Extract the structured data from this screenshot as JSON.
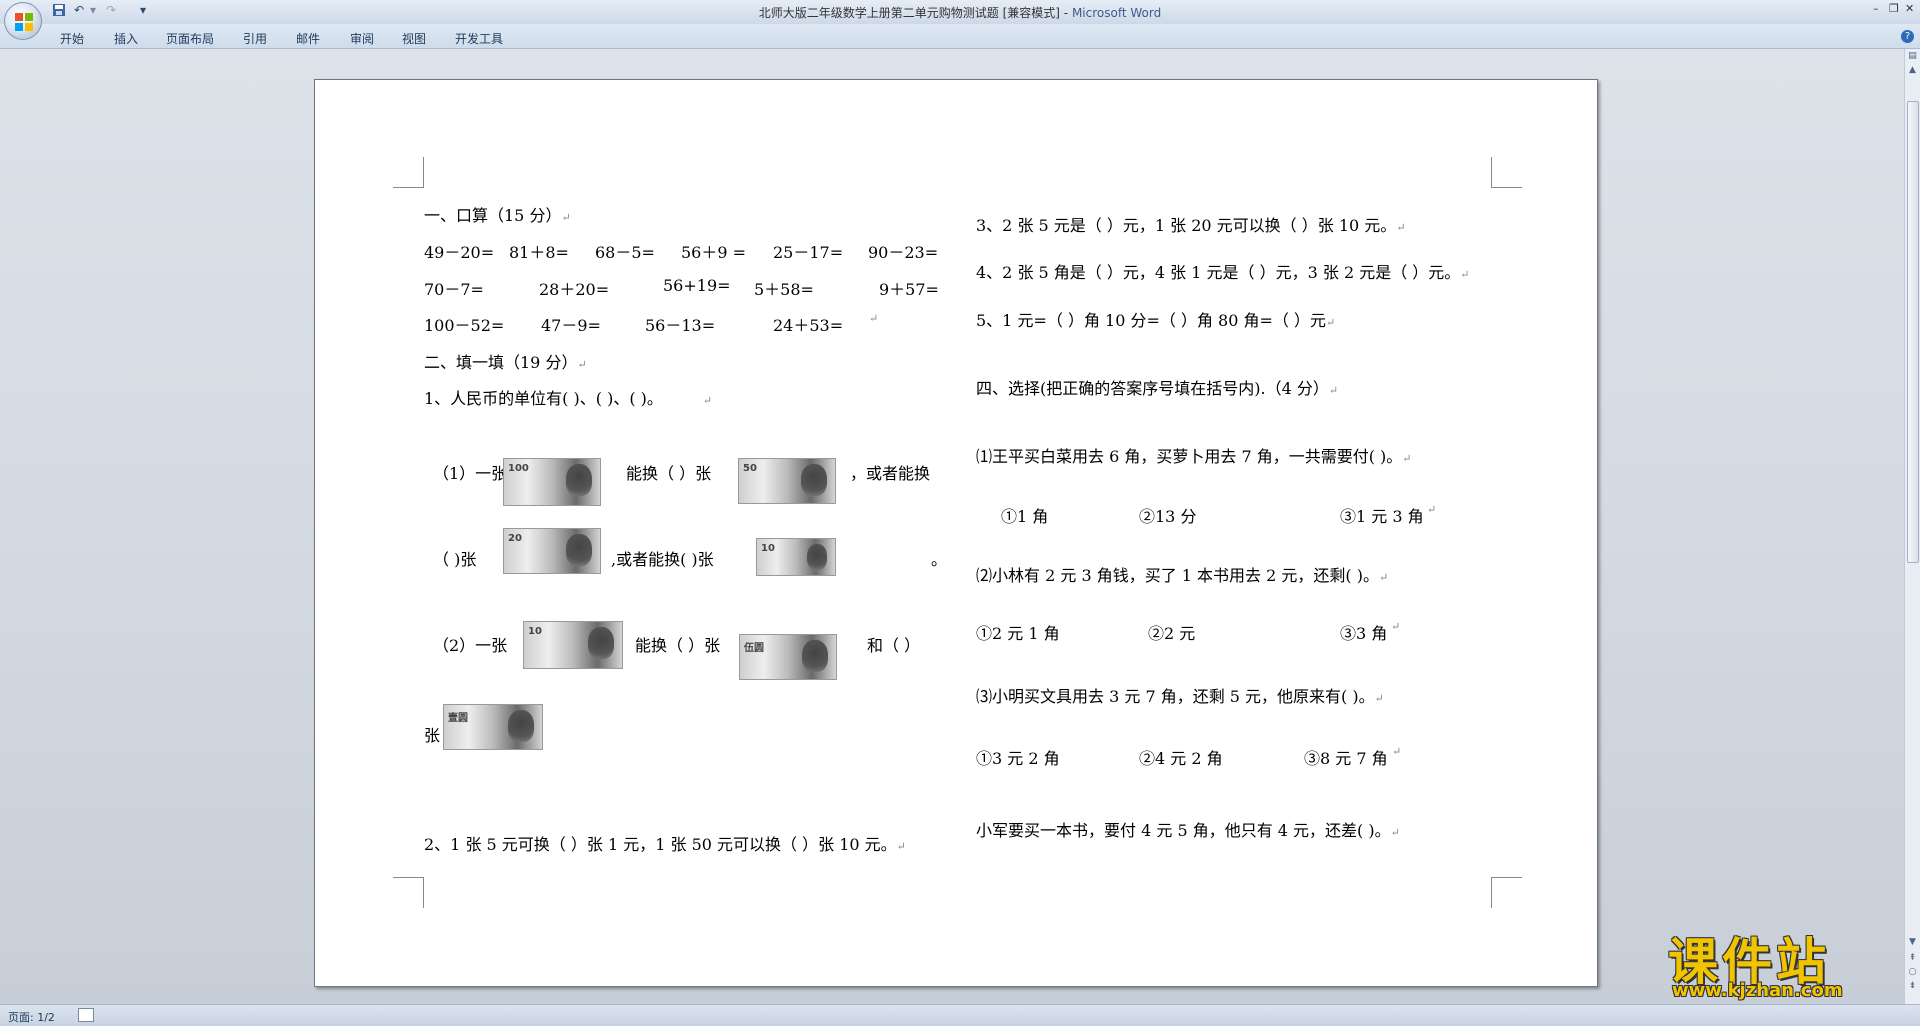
{
  "titlebar": {
    "doc_title": "北师大版二年级数学上册第二单元购物测试题 [兼容模式]",
    "separator": " - ",
    "app_name": "Microsoft Word",
    "qa_customize": "▾"
  },
  "tabs": [
    "开始",
    "插入",
    "页面布局",
    "引用",
    "邮件",
    "审阅",
    "视图",
    "开发工具"
  ],
  "help": "?",
  "document": {
    "left": {
      "sec1": "一、口算（15 分）",
      "r1": [
        "49－20=",
        "81＋8=",
        "68－5=",
        "56＋9 =",
        "25－17=",
        "90－23="
      ],
      "r2": [
        "70－7=",
        "28＋20=",
        "56+19=",
        "5＋58=",
        "9＋57="
      ],
      "r3": [
        "100－52=",
        "47－9=",
        "56－13=",
        "24＋53="
      ],
      "sec2": "二、填一填（19 分）",
      "q1": "1、人民币的单位有(          )、(          )、(          )。",
      "q1a_prefix": "（1）一张",
      "q1a_mid": "能换（    ）张",
      "q1a_suffix": "，或者能换",
      "q1b_prefix": "（    )张",
      "q1b_mid": ",或者能换(    )张",
      "q1b_end": "。",
      "q2a_prefix": "（2）一张",
      "q2a_mid": "能换（  ）张",
      "q2a_suffix": "和（    ）",
      "q2b_prefix": "张",
      "q2": "2、1 张 5 元可换（    ）张 1 元，1 张 50 元可以换（    ）张 10 元。"
    },
    "right": {
      "q3": "3、2 张 5 元是（       ）元，1 张 20 元可以换（        ）张 10 元。",
      "q4": "4、2 张 5 角是（   ）元，4 张 1 元是（  ）元，3 张 2 元是（  ）元。",
      "q5": "5、1 元=（   ）角    10 分=（    ）角   80 角=（   ）元",
      "sec4": "四、选择(把正确的答案序号填在括号内).（4 分）",
      "c1": "⑴王平买白菜用去 6 角，买萝卜用去 7 角，一共需要付(       )。",
      "c1_opts": [
        "①1 角",
        "②13 分",
        "③1 元 3 角"
      ],
      "c2": "⑵小林有 2 元 3 角钱，买了 1 本书用去 2 元，还剩(       )。",
      "c2_opts": [
        "①2 元 1 角",
        "②2 元",
        "③3 角"
      ],
      "c3": "⑶小明买文具用去 3 元 7 角，还剩 5 元，他原来有(              )。",
      "c3_opts": [
        "①3 元 2 角",
        "②4 元 2 角",
        "③8 元 7 角"
      ],
      "c4": "小军要买一本书，要付 4 元 5 角，他只有 4 元，还差(        )。"
    },
    "paragraph_mark": "↵",
    "banknotes": {
      "n100": "100",
      "n50": "50",
      "n20": "20",
      "n10": "10",
      "n5": "伍圆",
      "n1": "壹圆"
    }
  },
  "statusbar": {
    "page": "页面: 1/2"
  },
  "watermark": {
    "title": "课件站",
    "url": "www.kjzhan.com"
  }
}
